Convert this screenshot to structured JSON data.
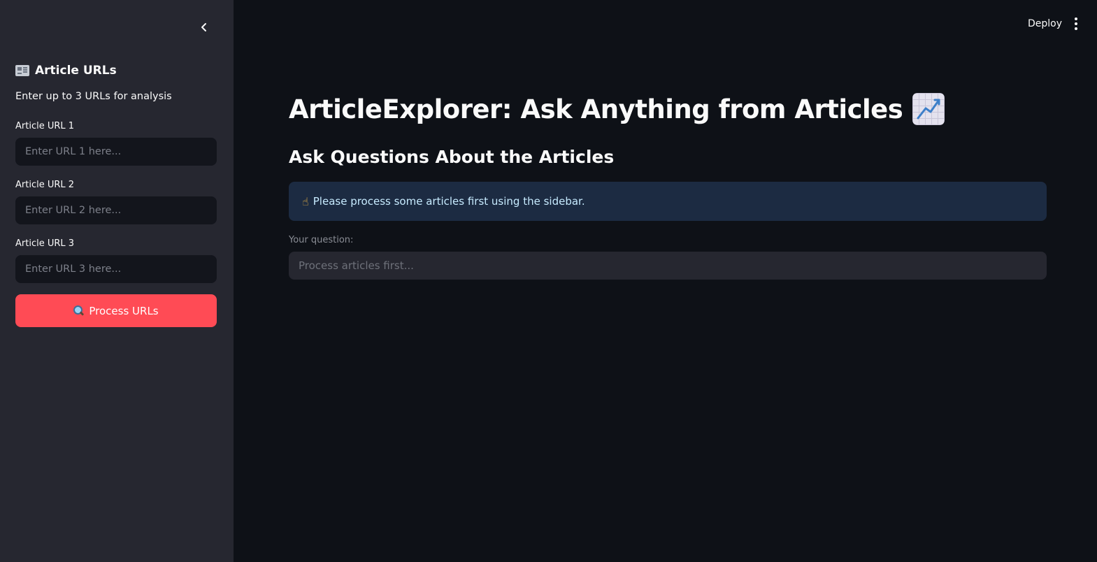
{
  "sidebar": {
    "heading": "Article URLs",
    "heading_icon": "newspaper-icon",
    "description": "Enter up to 3 URLs for analysis",
    "fields": [
      {
        "label": "Article URL 1",
        "placeholder": "Enter URL 1 here...",
        "value": ""
      },
      {
        "label": "Article URL 2",
        "placeholder": "Enter URL 2 here...",
        "value": ""
      },
      {
        "label": "Article URL 3",
        "placeholder": "Enter URL 3 here...",
        "value": ""
      }
    ],
    "process_button": {
      "label": "Process URLs",
      "icon": "magnifying-glass-icon"
    },
    "collapse_icon": "chevron-left-icon"
  },
  "header": {
    "deploy_label": "Deploy",
    "menu_icon": "kebab-menu-icon"
  },
  "main": {
    "title": "ArticleExplorer: Ask Anything from Articles",
    "title_icon": "chart-increasing-icon",
    "subheading": "Ask Questions About the Articles",
    "info_message": "Please process some articles first using the sidebar.",
    "info_icon": "pointing-hand-icon",
    "question_label": "Your question:",
    "question_placeholder": "Process articles first...",
    "question_value": ""
  },
  "colors": {
    "background": "#0e1117",
    "sidebar": "#262730",
    "primary_button": "#ff4b55",
    "info_box": "#1c2b42",
    "info_text": "#c7ebff"
  }
}
